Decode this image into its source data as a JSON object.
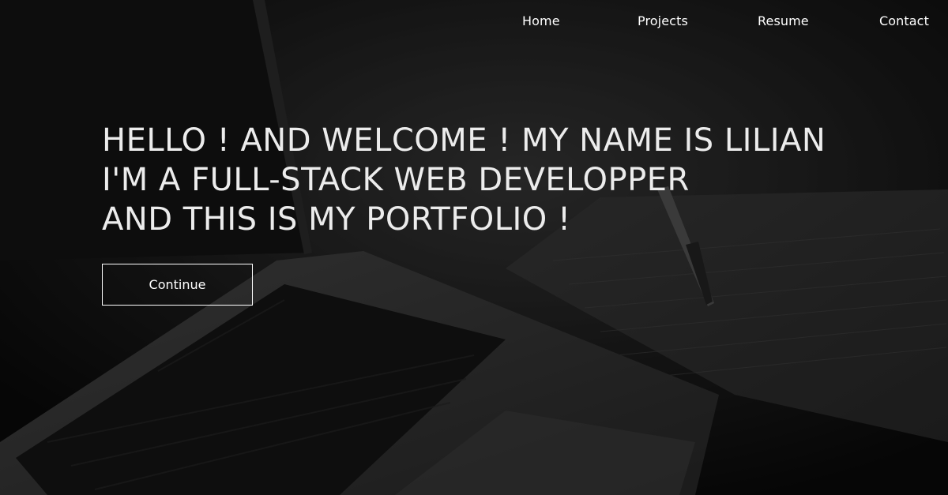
{
  "nav": {
    "items": [
      {
        "label": "Home"
      },
      {
        "label": "Projects"
      },
      {
        "label": "Resume"
      },
      {
        "label": "Contact"
      }
    ]
  },
  "hero": {
    "lines": [
      "HELLO ! AND WELCOME ! MY NAME IS LILIAN",
      "I'M A FULL-STACK WEB DEVELOPPER",
      "AND THIS IS MY PORTFOLIO !"
    ],
    "button_label": "Continue"
  },
  "colors": {
    "background": "#0d0d0d",
    "text": "#ececec",
    "button_border": "#ffffff"
  },
  "background_image": "laptop-and-notebook-photo"
}
